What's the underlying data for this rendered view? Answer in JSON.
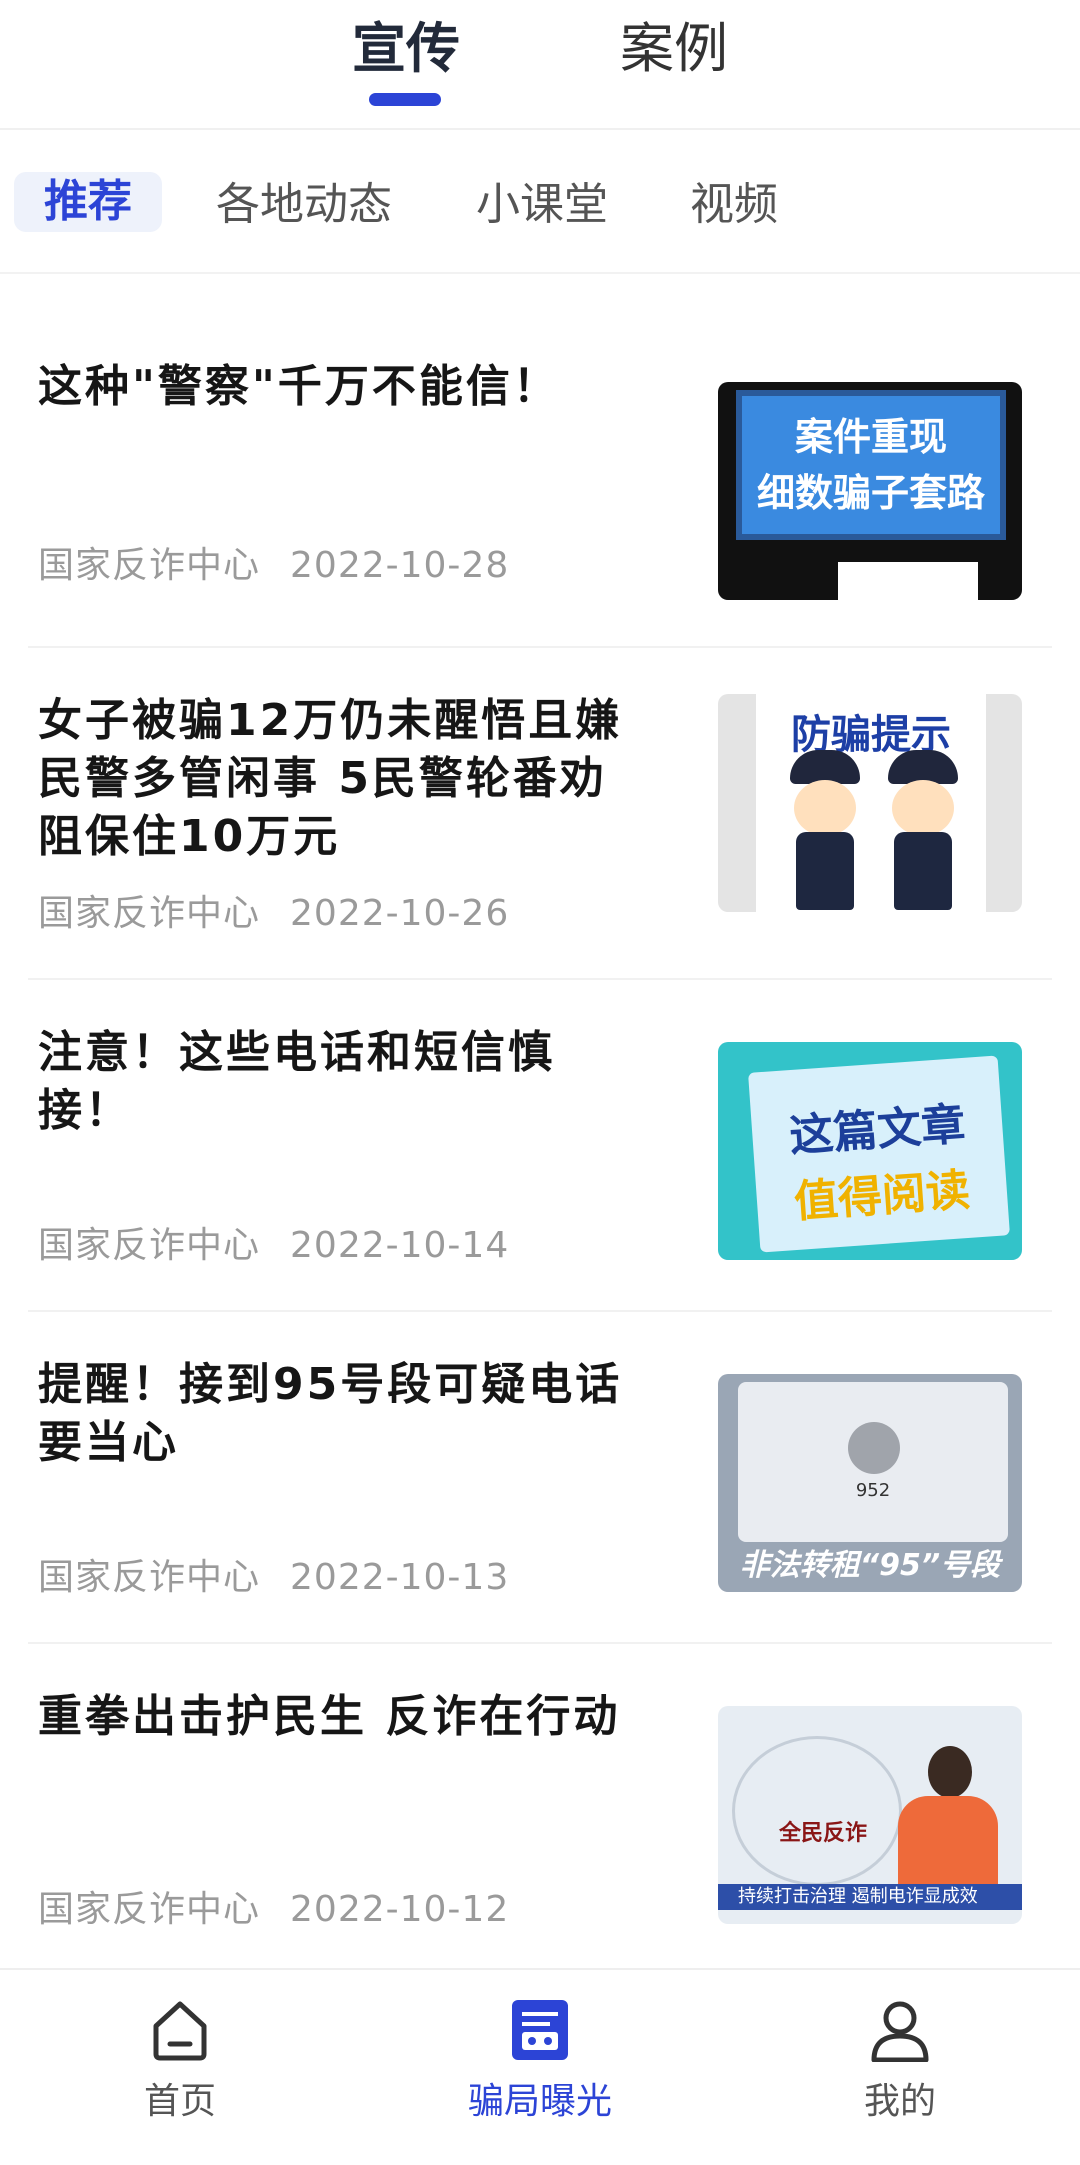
{
  "top_tabs": {
    "tab1": "宣传",
    "tab2": "案例",
    "active": "宣传",
    "accent": "#2c44d6"
  },
  "categories": [
    "推荐",
    "各地动态",
    "小课堂",
    "视频"
  ],
  "articles": [
    {
      "title": "这种\"警察\"千万不能信！",
      "source": "国家反诈中心",
      "date": "2022-10-28",
      "thumb_text": [
        "案件重现",
        "细数骗子套路"
      ]
    },
    {
      "title": "女子被骗12万仍未醒悟且嫌民警多管闲事 5民警轮番劝阻保住10万元",
      "source": "国家反诈中心",
      "date": "2022-10-26",
      "thumb_text": [
        "防骗提示"
      ]
    },
    {
      "title": "注意！这些电话和短信慎接！",
      "source": "国家反诈中心",
      "date": "2022-10-14",
      "thumb_text": [
        "这篇文章",
        "值得阅读"
      ]
    },
    {
      "title": "提醒！接到95号段可疑电话要当心",
      "source": "国家反诈中心",
      "date": "2022-10-13",
      "thumb_text": [
        "非法转租“95”号段",
        "952"
      ]
    },
    {
      "title": "重拳出击护民生 反诈在行动",
      "source": "国家反诈中心",
      "date": "2022-10-12",
      "thumb_text": [
        "全民反诈",
        "持续打击治理 遏制电诈显成效"
      ]
    }
  ],
  "bottom_nav": [
    {
      "label": "首页",
      "icon": "home-icon"
    },
    {
      "label": "骗局曝光",
      "icon": "exposure-icon",
      "active": true
    },
    {
      "label": "我的",
      "icon": "user-icon"
    }
  ]
}
